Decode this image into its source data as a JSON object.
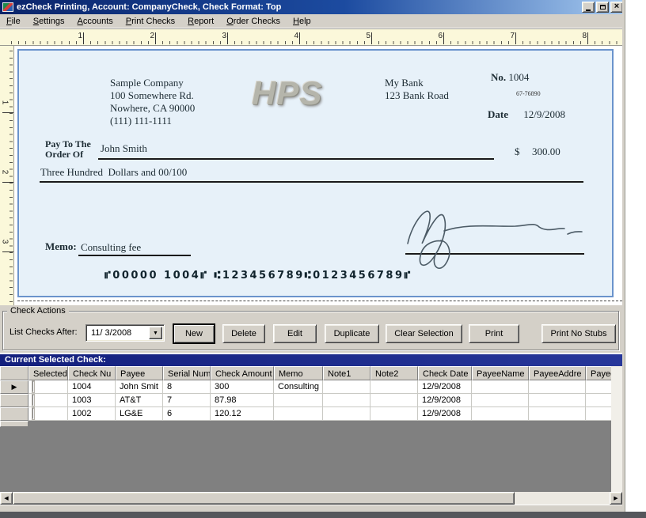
{
  "window": {
    "title": "ezCheck Printing, Account: CompanyCheck, Check Format: Top"
  },
  "menu": {
    "items": [
      "File",
      "Settings",
      "Accounts",
      "Print Checks",
      "Report",
      "Order Checks",
      "Help"
    ]
  },
  "ruler": {
    "horizontal": [
      "1",
      "2",
      "3",
      "4",
      "5",
      "6",
      "7",
      "8"
    ],
    "vertical": [
      "1",
      "2",
      "3"
    ]
  },
  "check": {
    "company_name": "Sample Company",
    "company_address1": "100 Somewhere Rd.",
    "company_address2": "Nowhere, CA 90000",
    "company_phone": "(111) 111-1111",
    "logo_text": "HPS",
    "bank_name": "My Bank",
    "bank_address": "123 Bank Road",
    "number_label": "No.",
    "number_value": "1004",
    "fraction": "67-76890",
    "date_label": "Date",
    "date_value": "12/9/2008",
    "pay_to_line1": "Pay To The",
    "pay_to_line2": "Order Of",
    "payee": "John Smith",
    "currency_symbol": "$",
    "amount": "300.00",
    "amount_words": "Three Hundred  Dollars and 00/100",
    "memo_label": "Memo:",
    "memo_value": "Consulting fee",
    "micr_line": "⑈00000 1004⑈  ⑆123456789⑆0123456789⑈"
  },
  "check_actions": {
    "group_title": "Check Actions",
    "filter_label": "List Checks After:",
    "filter_value": "11/ 3/2008",
    "buttons": [
      "New",
      "Delete",
      "Edit",
      "Duplicate",
      "Clear Selection",
      "Print",
      "Print No Stubs"
    ]
  },
  "grid": {
    "section_title": "Current Selected Check:",
    "columns": [
      "Selected",
      "Check Nu",
      "Payee",
      "Serial Num",
      "Check Amount",
      "Memo",
      "Note1",
      "Note2",
      "Check Date",
      "PayeeName",
      "PayeeAddre",
      "PayeeAc"
    ],
    "rows": [
      [
        "1004",
        "John Smit",
        "8",
        "300",
        "Consulting",
        "",
        "",
        "12/9/2008",
        "",
        "",
        ""
      ],
      [
        "1003",
        "AT&T",
        "7",
        "87.98",
        "",
        "",
        "",
        "12/9/2008",
        "",
        "",
        ""
      ],
      [
        "1002",
        "LG&E",
        "6",
        "120.12",
        "",
        "",
        "",
        "12/9/2008",
        "",
        "",
        ""
      ]
    ]
  }
}
